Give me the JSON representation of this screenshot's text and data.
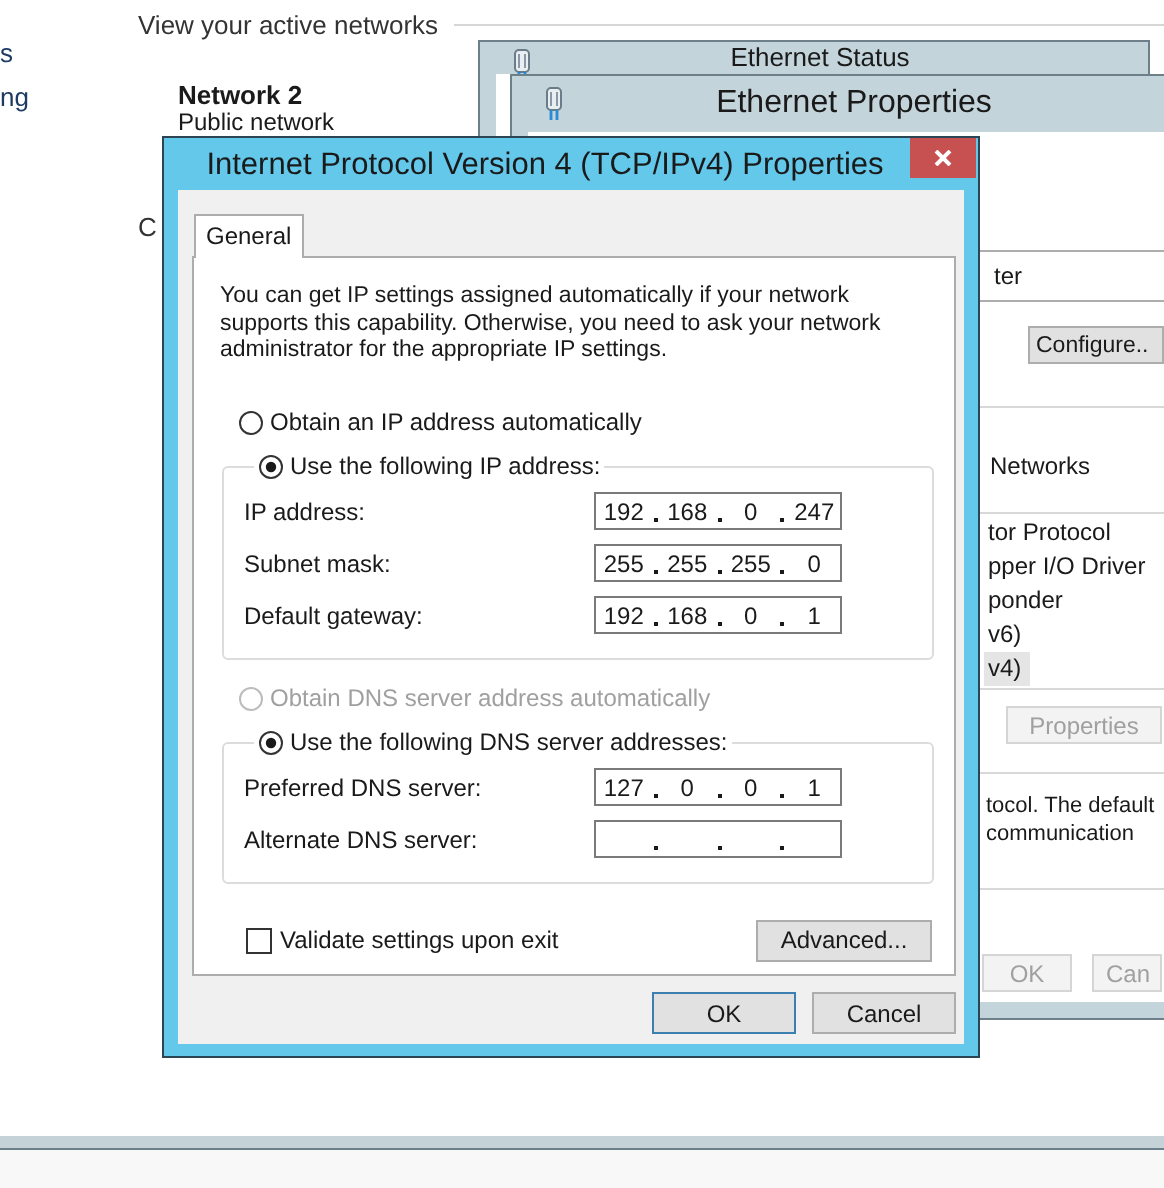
{
  "background": {
    "sidebar_items": [
      "s",
      "ng"
    ],
    "heading": "View your active networks",
    "network_name": "Network 2",
    "network_type": "Public network",
    "section_label": "C"
  },
  "status_window": {
    "title": "Ethernet Status"
  },
  "properties_window": {
    "title": "Ethernet Properties",
    "adapter": "ter",
    "configure_button": "Configure..",
    "list_heading": "Networks",
    "items": [
      {
        "label": "tor Protocol",
        "selected": false
      },
      {
        "label": "pper I/O Driver",
        "selected": false
      },
      {
        "label": "ponder",
        "selected": false
      },
      {
        "label": "v6)",
        "selected": false
      },
      {
        "label": "v4)",
        "selected": true
      }
    ],
    "properties_button": {
      "label": "Properties",
      "disabled": true
    },
    "description": [
      "tocol. The default",
      "communication"
    ],
    "buttons": [
      {
        "label": "OK",
        "disabled": true
      },
      {
        "label": "Can",
        "disabled": true
      }
    ]
  },
  "dialog": {
    "title": "Internet Protocol Version 4 (TCP/IPv4) Properties",
    "tabs": [
      {
        "label": "General",
        "selected": true
      }
    ],
    "intro": "You can get IP settings assigned automatically if your network supports this capability. Otherwise, you need to ask your network administrator for the appropriate IP settings.",
    "ip_options": [
      {
        "label": "Obtain an IP address automatically",
        "selected": false,
        "disabled": false
      },
      {
        "label": "Use the following IP address:",
        "selected": true,
        "disabled": false
      }
    ],
    "ip_fields": [
      {
        "label": "IP address:",
        "octets": [
          "192",
          "168",
          "0",
          "247"
        ]
      },
      {
        "label": "Subnet mask:",
        "octets": [
          "255",
          "255",
          "255",
          "0"
        ]
      },
      {
        "label": "Default gateway:",
        "octets": [
          "192",
          "168",
          "0",
          "1"
        ]
      }
    ],
    "dns_options": [
      {
        "label": "Obtain DNS server address automatically",
        "selected": false,
        "disabled": true
      },
      {
        "label": "Use the following DNS server addresses:",
        "selected": true,
        "disabled": false
      }
    ],
    "dns_fields": [
      {
        "label": "Preferred DNS server:",
        "octets": [
          "127",
          "0",
          "0",
          "1"
        ]
      },
      {
        "label": "Alternate DNS server:"
      }
    ],
    "validate": {
      "label": "Validate settings upon exit",
      "checked": false
    },
    "advanced_button": "Advanced...",
    "buttons": [
      {
        "label": "OK",
        "default": true
      },
      {
        "label": "Cancel",
        "default": false
      }
    ]
  }
}
